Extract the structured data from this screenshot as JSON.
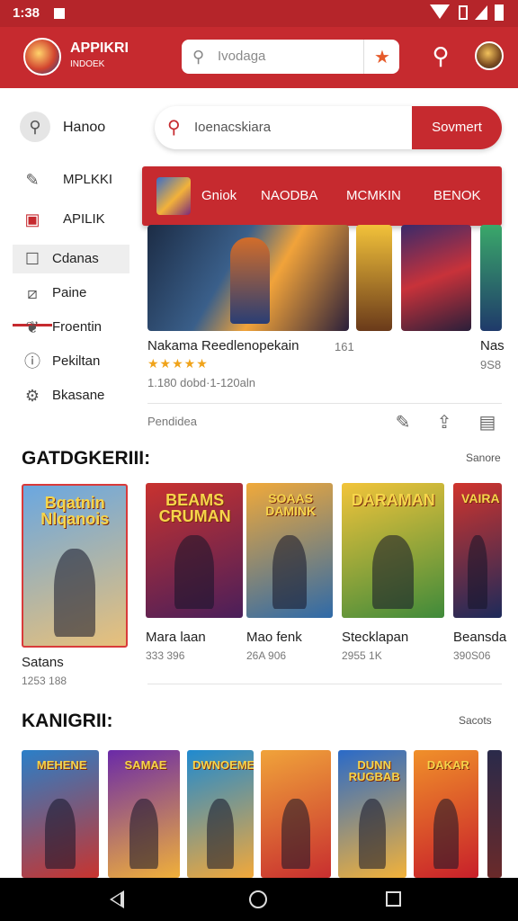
{
  "status": {
    "time": "1:38"
  },
  "appbar": {
    "title": "APPIKRI",
    "subtitle": "INDOEK",
    "search_placeholder": "Ivodaga"
  },
  "sidebar": {
    "items": [
      {
        "label": "Hanoo",
        "icon": "search-icon"
      },
      {
        "label": "MPLKKI",
        "icon": "pencil-icon"
      },
      {
        "label": "APILIK",
        "icon": "app-icon"
      },
      {
        "label": "Cdanas",
        "icon": "square-icon"
      },
      {
        "label": "Paine",
        "icon": "image-icon"
      },
      {
        "label": "Froentin",
        "icon": "leaf-icon"
      },
      {
        "label": "Pekiltan",
        "icon": "info-icon"
      },
      {
        "label": "Bkasane",
        "icon": "settings-icon"
      }
    ]
  },
  "main_search": {
    "placeholder": "Ioenacskiara",
    "button": "Sovmert"
  },
  "category_tabs": [
    "Gniok",
    "NAODBA",
    "MCMKIN",
    "BENOK"
  ],
  "featured": {
    "title": "Nakama Reedlenopekain",
    "side_value": "161",
    "rating": "★★★★★",
    "meta": "1.180 dobd·1-120aln",
    "next_caption": "Nas",
    "next_num": "9S8",
    "footer_label": "Pendidea"
  },
  "section1": {
    "title": "GATDGKERIII:",
    "see_all": "Sanore",
    "games": [
      {
        "art_title": "Bqatnin Nlqanois",
        "caption": "Satans",
        "num": "1253 188",
        "colors": [
          "#6aa7e0",
          "#e8c07a"
        ]
      },
      {
        "art_title": "BEAMS CRUMAN",
        "caption": "Mara laan",
        "num": "333 396",
        "colors": [
          "#c8322f",
          "#4a1f5a"
        ]
      },
      {
        "art_title": "SOAAS DAMINK",
        "caption": "Mao fenk",
        "num": "26A 906",
        "colors": [
          "#f0a93a",
          "#2f6aa8"
        ]
      },
      {
        "art_title": "DARAMAN",
        "caption": "Stecklapan",
        "num": "2955 1K",
        "colors": [
          "#f2c43a",
          "#3f8a3a"
        ]
      },
      {
        "art_title": "VAIRA",
        "caption": "Beansda",
        "num": "390S06",
        "colors": [
          "#d0342d",
          "#1d2a5a"
        ]
      }
    ]
  },
  "section2": {
    "title": "KANIGRII:",
    "see_all": "Sacots",
    "games": [
      {
        "art_title": "MEHENE",
        "colors": [
          "#2a7fc8",
          "#c8342f"
        ]
      },
      {
        "art_title": "SAMAE",
        "colors": [
          "#6a2aa8",
          "#f0b03a"
        ]
      },
      {
        "art_title": "DWNOEME",
        "colors": [
          "#1f8ad0",
          "#f2a83a"
        ]
      },
      {
        "art_title": "",
        "colors": [
          "#f0a33a",
          "#c82f2f"
        ]
      },
      {
        "art_title": "DUNN RUGBAB",
        "colors": [
          "#2a6ac8",
          "#f2b23a"
        ]
      },
      {
        "art_title": "DAKAR",
        "colors": [
          "#f0902a",
          "#c8202a"
        ]
      }
    ]
  }
}
